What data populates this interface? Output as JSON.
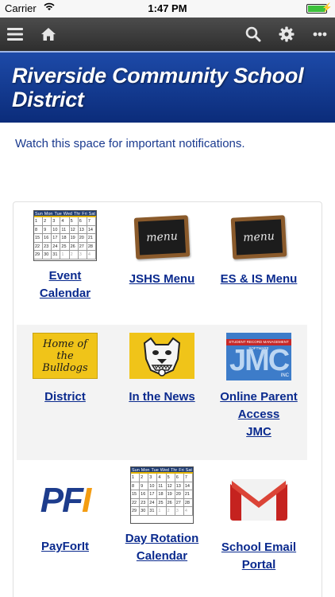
{
  "status_bar": {
    "carrier": "Carrier",
    "time": "1:47 PM"
  },
  "toolbar": {
    "icons": [
      "menu-icon",
      "home-icon",
      "search-icon",
      "gear-icon",
      "more-icon"
    ]
  },
  "banner": {
    "title": "Riverside Community School District"
  },
  "notice": {
    "text": "Watch this space for important notifications."
  },
  "calendar_icon": {
    "weekdays": [
      "Sun",
      "Mon",
      "Tue",
      "Wed",
      "Thr",
      "Fri",
      "Sat"
    ],
    "days": [
      "1",
      "2",
      "3",
      "4",
      "5",
      "6",
      "7",
      "8",
      "9",
      "10",
      "11",
      "12",
      "13",
      "14",
      "15",
      "16",
      "17",
      "18",
      "19",
      "20",
      "21",
      "22",
      "23",
      "24",
      "25",
      "26",
      "27",
      "28",
      "29",
      "30",
      "31",
      "1",
      "2",
      "3",
      "4"
    ]
  },
  "chalk_text": "menu",
  "tiles": [
    {
      "name": "event-calendar",
      "label_lines": [
        "Event",
        "Calendar"
      ]
    },
    {
      "name": "jshs-menu",
      "label_lines": [
        "JSHS Menu"
      ]
    },
    {
      "name": "es-is-menu",
      "label_lines": [
        "ES & IS Menu"
      ]
    },
    {
      "name": "district",
      "label_lines": [
        "District"
      ],
      "image_text_lines": [
        "Home of",
        "the Bulldogs"
      ]
    },
    {
      "name": "in-the-news",
      "label_lines": [
        "In the News"
      ]
    },
    {
      "name": "online-parent-access",
      "label_lines": [
        "Online Parent",
        "Access",
        "JMC"
      ],
      "image_strip": "STUDENT RECORD MANAGEMENT SOFTWARE",
      "image_big": "JMC",
      "image_inc": "INC"
    },
    {
      "name": "payforit",
      "label_lines": [
        "PayForIt"
      ],
      "image_text": "PFI"
    },
    {
      "name": "day-rotation-calendar",
      "label_lines": [
        "Day Rotation",
        "Calendar"
      ]
    },
    {
      "name": "school-email-portal",
      "label_lines": [
        "School Email",
        "Portal"
      ]
    }
  ],
  "colors": {
    "banner": "#0b2c7a",
    "link": "#0a2a8e",
    "toolbar": "#3a3a3a"
  }
}
